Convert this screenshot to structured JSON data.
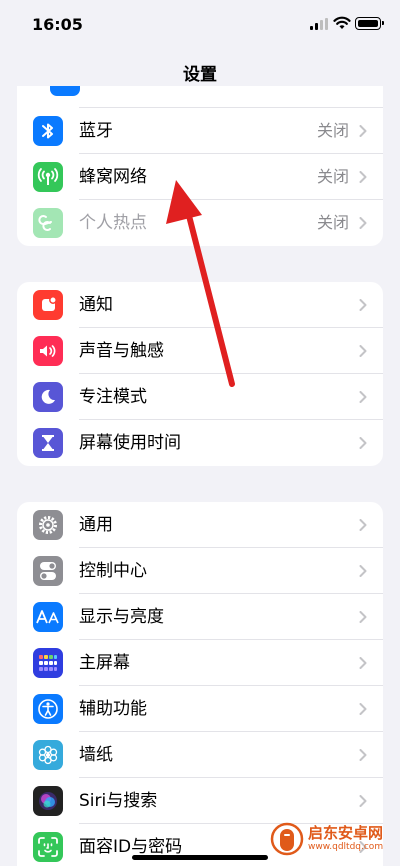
{
  "status_bar": {
    "time": "16:05"
  },
  "nav": {
    "title": "设置"
  },
  "group1": {
    "rows": [
      {
        "label": "蓝牙",
        "value": "关闭",
        "icon": "bluetooth-icon",
        "color": "#0a7aff"
      },
      {
        "label": "蜂窝网络",
        "value": "关闭",
        "icon": "antenna-icon",
        "color": "#34c759"
      },
      {
        "label": "个人热点",
        "value": "关闭",
        "icon": "hotspot-icon",
        "color": "#34c759"
      }
    ]
  },
  "group2": {
    "rows": [
      {
        "label": "通知",
        "icon": "bell-icon",
        "color": "#ff3b30"
      },
      {
        "label": "声音与触感",
        "icon": "speaker-icon",
        "color": "#ff2d55"
      },
      {
        "label": "专注模式",
        "icon": "moon-icon",
        "color": "#5856d6"
      },
      {
        "label": "屏幕使用时间",
        "icon": "hourglass-icon",
        "color": "#5856d6"
      }
    ]
  },
  "group3": {
    "rows": [
      {
        "label": "通用",
        "icon": "gear-icon",
        "color": "#8e8e93"
      },
      {
        "label": "控制中心",
        "icon": "toggles-icon",
        "color": "#8e8e93"
      },
      {
        "label": "显示与亮度",
        "icon": "text-size-icon",
        "color": "#0a7aff"
      },
      {
        "label": "主屏幕",
        "icon": "home-grid-icon",
        "color": "#2f3de0"
      },
      {
        "label": "辅助功能",
        "icon": "accessibility-icon",
        "color": "#0a7aff"
      },
      {
        "label": "墙纸",
        "icon": "flower-icon",
        "color": "#35aadc"
      },
      {
        "label": "Siri与搜索",
        "icon": "siri-icon",
        "color": "#222222"
      },
      {
        "label": "面容ID与密码",
        "icon": "face-id-icon",
        "color": "#34c759"
      }
    ]
  },
  "annotation": {
    "arrow_color": "#e02020"
  },
  "watermark": {
    "name": "启东安卓网",
    "url": "www.qdltdq.com",
    "color": "#e05a1a"
  }
}
